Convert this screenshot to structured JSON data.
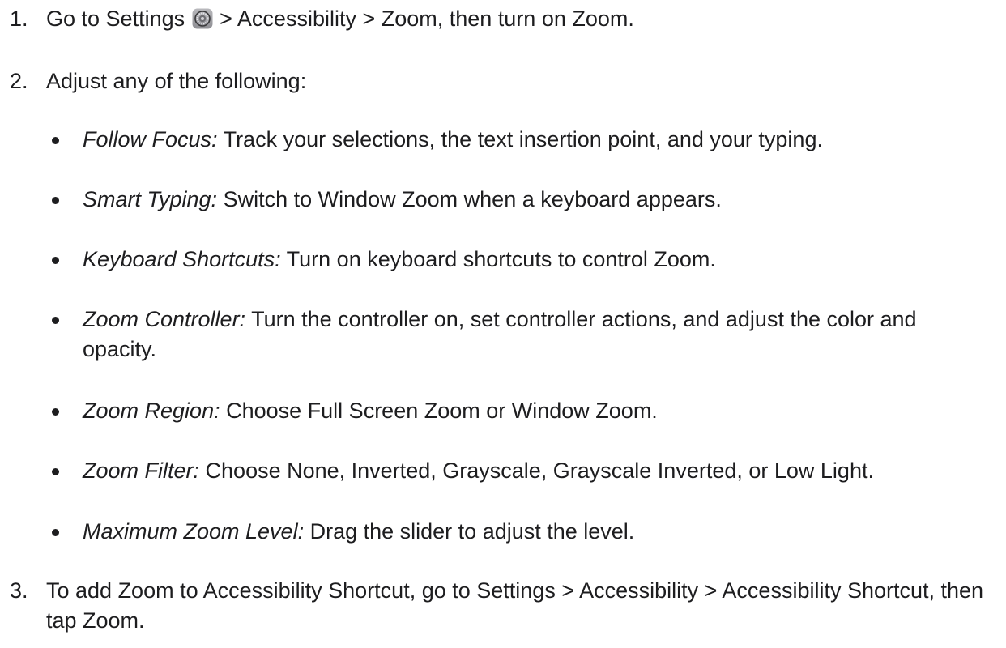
{
  "steps": [
    {
      "number": "1.",
      "before_icon": "Go to Settings",
      "icon": "settings-gear-icon",
      "after_icon": "> Accessibility > Zoom, then turn on Zoom."
    },
    {
      "number": "2.",
      "text": "Adjust any of the following:"
    },
    {
      "number": "3.",
      "text": "To add Zoom to Accessibility Shortcut, go to Settings > Accessibility > Accessibility Shortcut, then tap Zoom."
    }
  ],
  "options": [
    {
      "term": "Follow Focus:",
      "desc": "Track your selections, the text insertion point, and your typing."
    },
    {
      "term": "Smart Typing:",
      "desc": "Switch to Window Zoom when a keyboard appears."
    },
    {
      "term": "Keyboard Shortcuts:",
      "desc": "Turn on keyboard shortcuts to control Zoom."
    },
    {
      "term": "Zoom Controller:",
      "desc": "Turn the controller on, set controller actions, and adjust the color and opacity."
    },
    {
      "term": "Zoom Region:",
      "desc": "Choose Full Screen Zoom or Window Zoom."
    },
    {
      "term": "Zoom Filter:",
      "desc": "Choose None, Inverted, Grayscale, Grayscale Inverted, or Low Light."
    },
    {
      "term": "Maximum Zoom Level:",
      "desc": "Drag the slider to adjust the level."
    }
  ]
}
